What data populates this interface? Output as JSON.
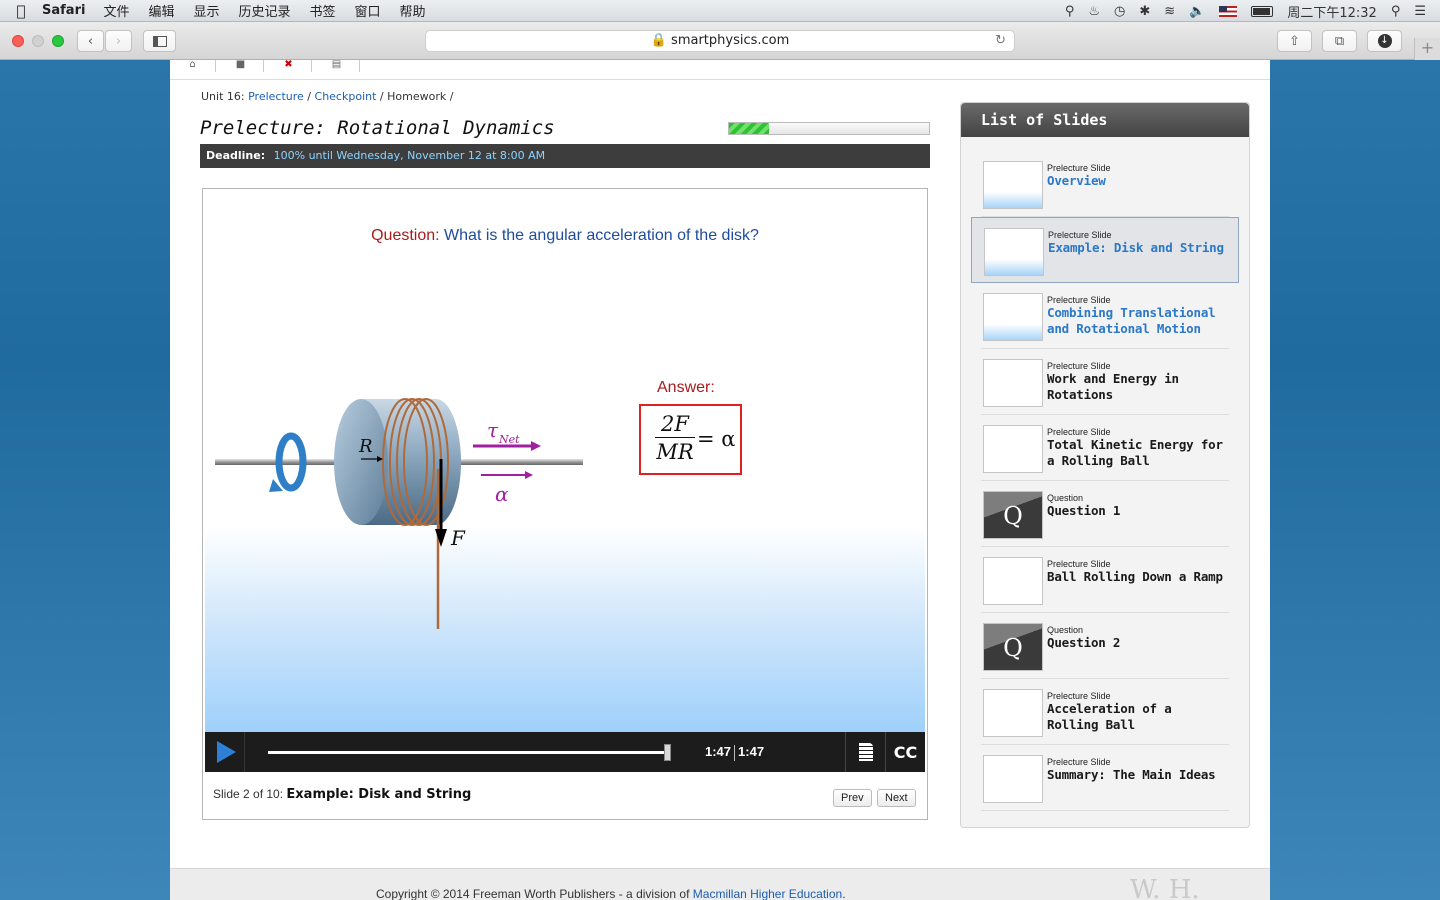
{
  "menubar": {
    "app": "Safari",
    "items": [
      "文件",
      "编辑",
      "显示",
      "历史记录",
      "书签",
      "窗口",
      "帮助"
    ],
    "clock": "周二下午12:32"
  },
  "browser": {
    "url": "smartphysics.com"
  },
  "breadcrumb": {
    "unit": "Unit 16:",
    "prelecture": "Prelecture",
    "checkpoint": "Checkpoint",
    "homework": "Homework",
    "sep": "/"
  },
  "page": {
    "title": "Prelecture: Rotational Dynamics",
    "progress": 0.2,
    "deadline_label": "Deadline:",
    "deadline_value": "100% until Wednesday, November 12 at 8:00 AM"
  },
  "slide": {
    "question_label": "Question:",
    "question_text": "What is the angular acceleration of the disk?",
    "answer_label": "Answer:",
    "answer_num": "2F",
    "answer_den": "MR",
    "answer_rhs": "= α",
    "labels": {
      "R": "R",
      "tau": "τ",
      "net": "Net",
      "alpha": "α",
      "F": "F"
    }
  },
  "player": {
    "time_current": "1:47",
    "time_total": "1:47",
    "cc": "CC",
    "played_fraction": 1.0
  },
  "footer": {
    "slide_count": "Slide 2 of 10:",
    "slide_title": "Example: Disk and String",
    "prev": "Prev",
    "next": "Next"
  },
  "sidebar": {
    "header": "List of Slides",
    "items": [
      {
        "kind": "Prelecture Slide",
        "name": "Overview"
      },
      {
        "kind": "Prelecture Slide",
        "name": "Example: Disk and String"
      },
      {
        "kind": "Prelecture Slide",
        "name": "Combining Translational and Rotational Motion"
      },
      {
        "kind": "Prelecture Slide",
        "name": "Work and Energy in Rotations"
      },
      {
        "kind": "Prelecture Slide",
        "name": "Total Kinetic Energy for a Rolling Ball"
      },
      {
        "kind": "Question",
        "name": "Question 1",
        "thumb_letter": "Q"
      },
      {
        "kind": "Prelecture Slide",
        "name": "Ball Rolling Down a Ramp"
      },
      {
        "kind": "Question",
        "name": "Question 2",
        "thumb_letter": "Q"
      },
      {
        "kind": "Prelecture Slide",
        "name": "Acceleration of a Rolling Ball"
      },
      {
        "kind": "Prelecture Slide",
        "name": "Summary: The Main Ideas"
      }
    ]
  },
  "copyright": {
    "text": "Copyright © 2014 Freeman Worth Publishers - a division of",
    "link": "Macmillan Higher Education",
    "end": ".",
    "logo": "W. H."
  },
  "colors": {
    "accent_link": "#1b5fb0",
    "answer_red": "#d22222",
    "question_blue": "#1e4c9c",
    "progress_green": "#2ec22e"
  }
}
